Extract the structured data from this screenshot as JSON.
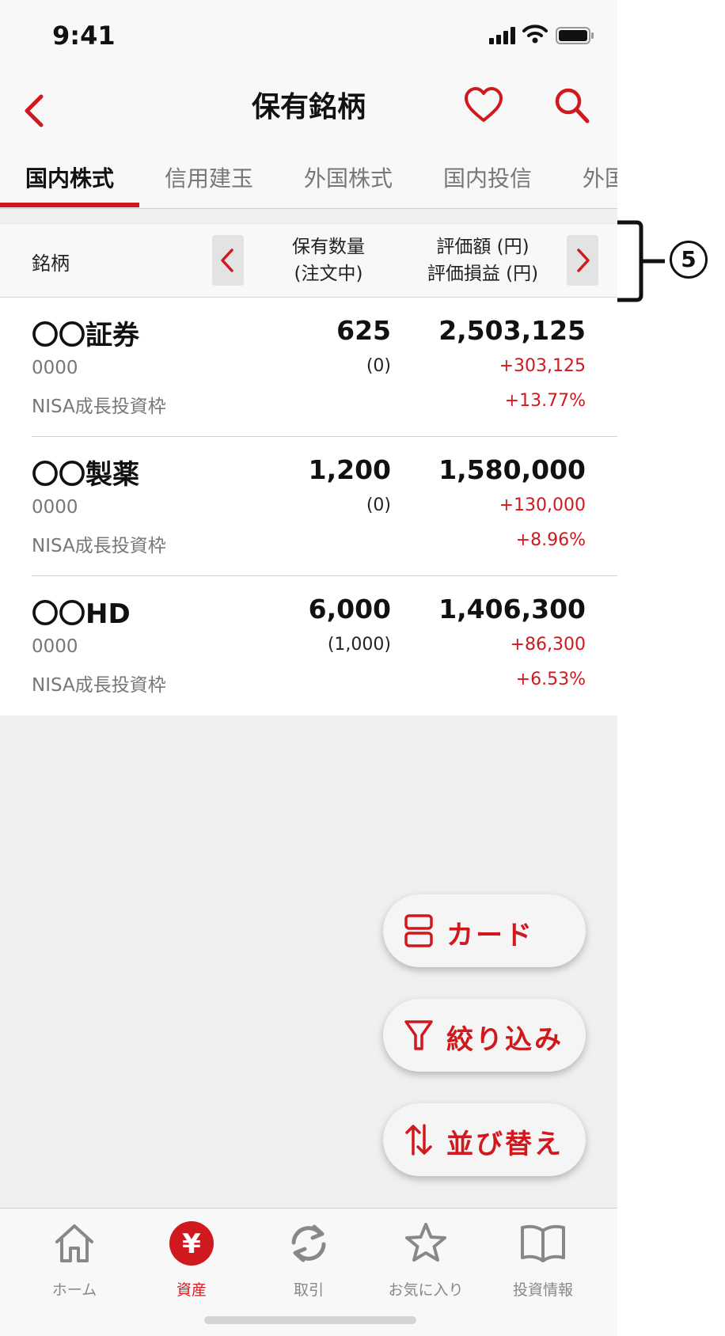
{
  "status_bar": {
    "time": "9:41"
  },
  "header": {
    "title": "保有銘柄"
  },
  "tabs": [
    "国内株式",
    "信用建玉",
    "外国株式",
    "国内投信",
    "外国"
  ],
  "columns": {
    "name": "銘柄",
    "qty_line1": "保有数量",
    "qty_line2": "(注文中)",
    "val_line1": "評価額 (円)",
    "val_line2": "評価損益 (円)"
  },
  "holdings": [
    {
      "name": "〇〇証券",
      "code": "0000",
      "account": "NISA成長投資枠",
      "qty": "625",
      "on_order": "(0)",
      "value": "2,503,125",
      "pl": "+303,125",
      "pl_pct": "+13.77%"
    },
    {
      "name": "〇〇製薬",
      "code": "0000",
      "account": "NISA成長投資枠",
      "qty": "1,200",
      "on_order": "(0)",
      "value": "1,580,000",
      "pl": "+130,000",
      "pl_pct": "+8.96%"
    },
    {
      "name": "〇〇HD",
      "code": "0000",
      "account": "NISA成長投資枠",
      "qty": "6,000",
      "on_order": "(1,000)",
      "value": "1,406,300",
      "pl": "+86,300",
      "pl_pct": "+6.53%"
    }
  ],
  "fabs": {
    "card": "カード",
    "filter": "絞り込み",
    "sort": "並び替え"
  },
  "tabbar": {
    "home": "ホーム",
    "assets": "資産",
    "assets_glyph": "¥",
    "trade": "取引",
    "favorites": "お気に入り",
    "info": "投資情報"
  },
  "annotation": {
    "number": "5"
  },
  "colors": {
    "accent": "#d0191e"
  },
  "icons": [
    "back-icon",
    "heart-icon",
    "search-icon",
    "chevron-left-icon",
    "chevron-right-icon",
    "card-layout-icon",
    "filter-icon",
    "sort-icon",
    "home-icon",
    "yen-icon",
    "refresh-icon",
    "star-icon",
    "book-icon"
  ]
}
